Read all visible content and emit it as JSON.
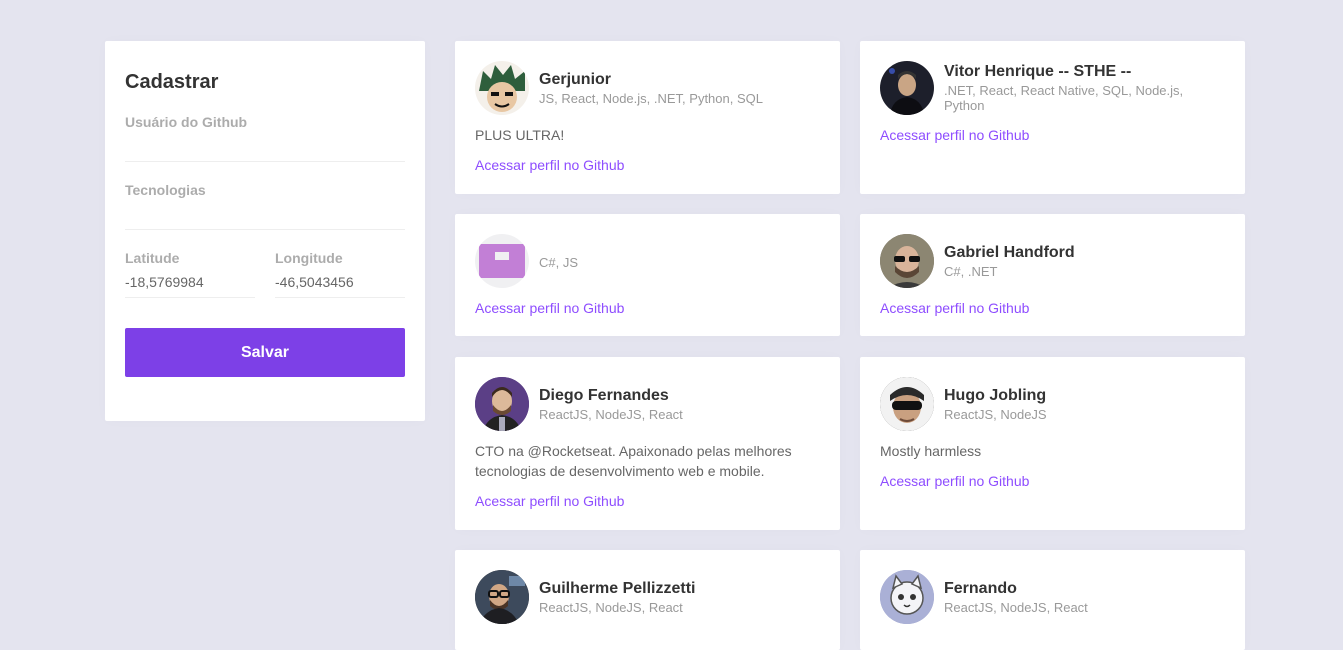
{
  "form": {
    "title": "Cadastrar",
    "github_label": "Usuário do Github",
    "github_value": "",
    "techs_label": "Tecnologias",
    "techs_value": "",
    "lat_label": "Latitude",
    "lat_value": "-18,5769984",
    "lng_label": "Longitude",
    "lng_value": "-46,5043456",
    "save_label": "Salvar"
  },
  "link_label": "Acessar perfil no Github",
  "devs": [
    {
      "name": "Gerjunior",
      "techs": "JS, React, Node.js, .NET, Python, SQL",
      "bio": "PLUS ULTRA!",
      "avatar_color": "#2e5e3c"
    },
    {
      "name": "Vitor Henrique -- STHE --",
      "techs": ".NET, React, React Native, SQL, Node.js, Python",
      "bio": "",
      "avatar_color": "#1d1f2b"
    },
    {
      "name": "",
      "techs": "C#, JS",
      "bio": "",
      "avatar_color": "#c27fd6"
    },
    {
      "name": "Gabriel Handford",
      "techs": "C#, .NET",
      "bio": "",
      "avatar_color": "#7b7566"
    },
    {
      "name": "Diego Fernandes",
      "techs": "ReactJS, NodeJS, React",
      "bio": "CTO na @Rocketseat. Apaixonado pelas melhores tecnologias de desenvolvimento web e mobile.",
      "avatar_color": "#5b3f86"
    },
    {
      "name": "Hugo Jobling",
      "techs": "ReactJS, NodeJS",
      "bio": "Mostly harmless",
      "avatar_color": "#3a3a3a"
    },
    {
      "name": "Guilherme Pellizzetti",
      "techs": "ReactJS, NodeJS, React",
      "bio": "",
      "avatar_color": "#4a4038"
    },
    {
      "name": "Fernando",
      "techs": "ReactJS, NodeJS, React",
      "bio": "",
      "avatar_color": "#9aa0c8"
    }
  ]
}
